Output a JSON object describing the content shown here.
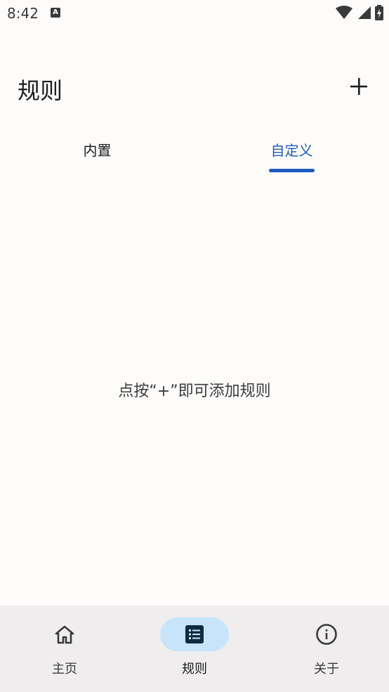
{
  "status_bar": {
    "time": "8:42",
    "notification_badge": "A",
    "icons": [
      "wifi-icon",
      "signal-icon",
      "battery-charging-icon"
    ]
  },
  "app_bar": {
    "title": "规则",
    "add_icon": "plus-icon"
  },
  "tabs": [
    {
      "label": "内置",
      "selected": false
    },
    {
      "label": "自定义",
      "selected": true
    }
  ],
  "empty_state": {
    "message": "点按“+”即可添加规则"
  },
  "bottom_nav": {
    "items": [
      {
        "label": "主页",
        "icon": "home-icon",
        "active": false
      },
      {
        "label": "规则",
        "icon": "list-icon",
        "active": true
      },
      {
        "label": "关于",
        "icon": "info-icon",
        "active": false
      }
    ]
  },
  "colors": {
    "accent": "#1f5bbd",
    "nav_active_pill": "#c7e4fb",
    "background": "#fdfcfb",
    "nav_background": "#efedee"
  }
}
